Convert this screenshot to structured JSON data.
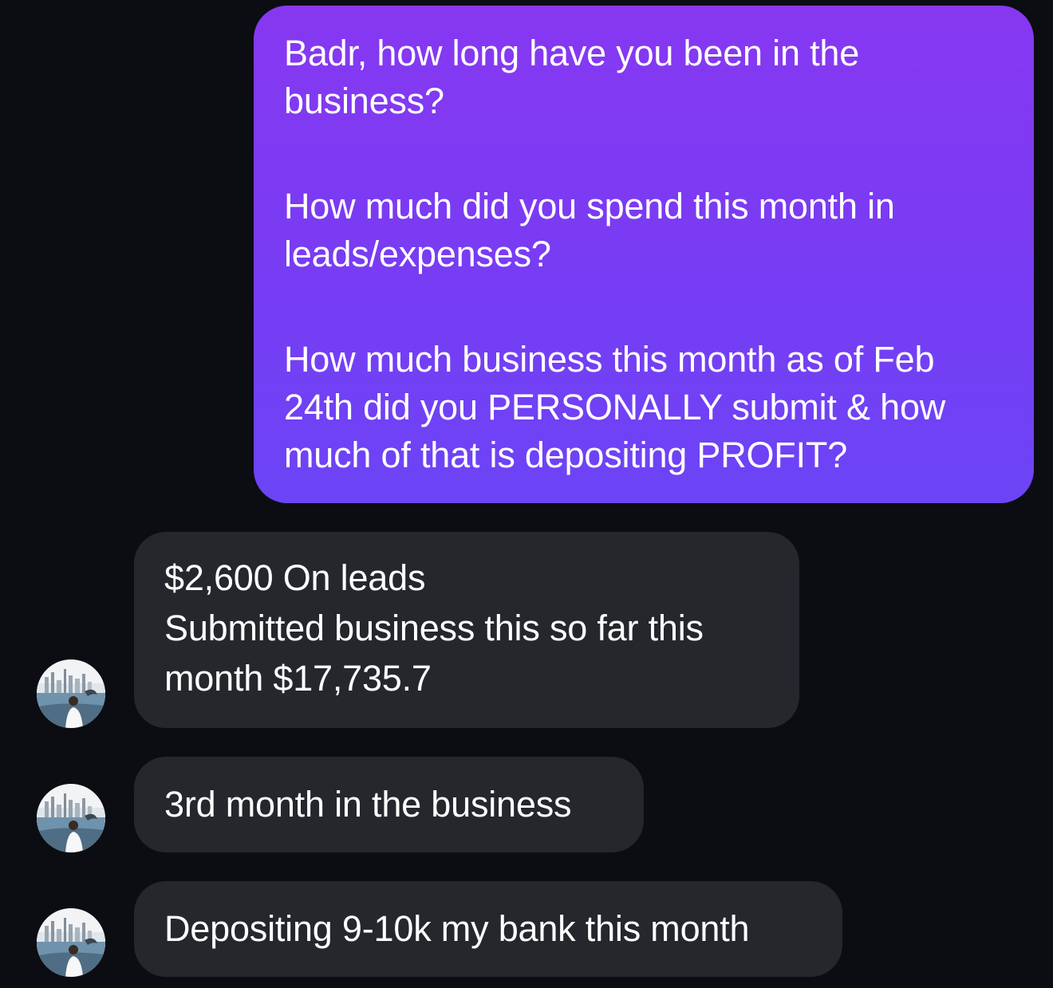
{
  "conversation": {
    "outgoing": {
      "paragraphs": [
        "Badr, how long have you been in the business?",
        "How much did you spend this month in leads/expenses?",
        "How much business this month as of Feb 24th did you PERSONALLY submit & how much of that is depositing PROFIT?"
      ]
    },
    "incoming": [
      {
        "lines": [
          "$2,600 On leads",
          "Submitted business this so far this",
          "month $17,735.7"
        ]
      },
      {
        "lines": [
          "3rd month in the business"
        ]
      },
      {
        "lines": [
          "Depositing 9-10k my bank this month"
        ]
      }
    ]
  },
  "theme": {
    "background": "#0b0d12",
    "outgoing_gradient_top": "#8738f1",
    "outgoing_gradient_bottom": "#6c44f6",
    "incoming_bubble": "#25272d",
    "text": "#ffffff"
  },
  "icons": {
    "avatar": "profile-photo-skyline-boat"
  }
}
